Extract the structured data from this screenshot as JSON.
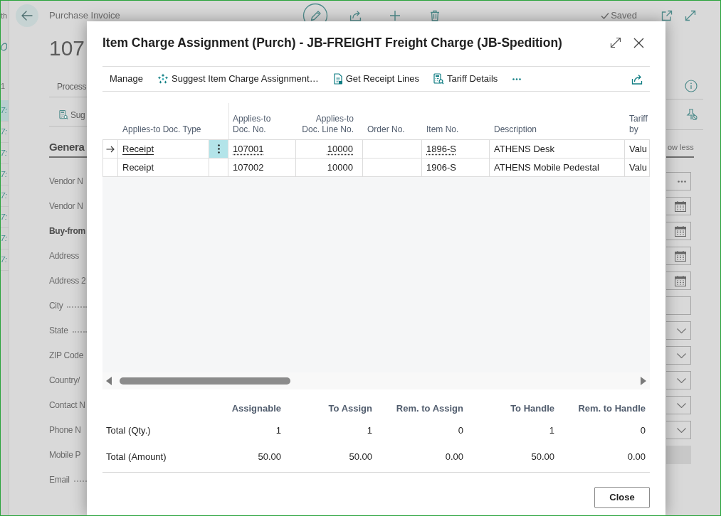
{
  "background_page": {
    "edge_strip": {
      "heading": "th",
      "label": "1",
      "rows": [
        {
          "text": "7:",
          "selected": true
        },
        {
          "text": "7:",
          "selected": false
        },
        {
          "text": "7:",
          "selected": false
        },
        {
          "text": "7:",
          "selected": false
        },
        {
          "text": "7:",
          "selected": false
        },
        {
          "text": "7:",
          "selected": false
        },
        {
          "text": "7:",
          "selected": false
        },
        {
          "text": "7:",
          "selected": false
        }
      ]
    },
    "title": "Purchase Invoice",
    "status": "Saved",
    "number": "107",
    "tab": "Process",
    "action": "Sug",
    "section": {
      "title": "Genera",
      "toggle": "ow less"
    },
    "labels": [
      {
        "text": "Vendor N",
        "kind": "plain"
      },
      {
        "text": "Vendor N",
        "kind": "plain"
      },
      {
        "text": "Buy-from",
        "kind": "group"
      },
      {
        "text": "Address",
        "kind": "plain"
      },
      {
        "text": "Address 2",
        "kind": "plain"
      },
      {
        "text": "City",
        "kind": "dotted"
      },
      {
        "text": "State",
        "kind": "dotted"
      },
      {
        "text": "ZIP Code",
        "kind": "plain"
      },
      {
        "text": "Country/",
        "kind": "plain"
      },
      {
        "text": "Contact N",
        "kind": "plain"
      },
      {
        "text": "Phone N",
        "kind": "plain"
      },
      {
        "text": "Mobile P",
        "kind": "plain"
      },
      {
        "text": "Email",
        "kind": "dotted"
      }
    ],
    "fields": [
      {
        "kind": "lookup"
      },
      {
        "kind": "date"
      },
      {
        "kind": "date"
      },
      {
        "kind": "date"
      },
      {
        "kind": "date"
      },
      {
        "kind": "text"
      },
      {
        "kind": "dropdown"
      },
      {
        "kind": "dropdown"
      },
      {
        "kind": "dropdown"
      },
      {
        "kind": "dropdown"
      },
      {
        "kind": "dropdown"
      },
      {
        "kind": "disabled"
      }
    ]
  },
  "dialog": {
    "title": "Item Charge Assignment (Purch) - JB-FREIGHT Freight Charge (JB-Spedition)",
    "actions": [
      {
        "label": "Manage",
        "kind": "menu"
      },
      {
        "label": "Suggest Item Charge Assignment…",
        "kind": "suggest"
      },
      {
        "label": "Get Receipt Lines",
        "kind": "receipt"
      },
      {
        "label": "Tariff Details",
        "kind": "tariff"
      }
    ],
    "table": {
      "columns": [
        {
          "label": "Applies-to Doc. Type",
          "kind": "link"
        },
        {
          "label": "Applies-to Doc. No.",
          "kind": "lookup"
        },
        {
          "label": "Applies-to Doc. Line No.",
          "kind": "number"
        },
        {
          "label": "Order No.",
          "kind": "text"
        },
        {
          "label": "Item No.",
          "kind": "lookup"
        },
        {
          "label": "Description",
          "kind": "text"
        },
        {
          "label": "Tariff by",
          "kind": "text"
        }
      ],
      "rows": [
        {
          "selected": true,
          "doc_type": "Receipt",
          "doc_no": "107001",
          "line_no": "10000",
          "item_no": "1896-S",
          "description": "ATHENS Desk",
          "tariff_by": "Valu"
        },
        {
          "selected": false,
          "doc_type": "Receipt",
          "doc_no": "107002",
          "line_no": "10000",
          "item_no": "1906-S",
          "description": "ATHENS Mobile Pedestal",
          "tariff_by": "Valu"
        }
      ]
    },
    "totals": {
      "columns": [
        "Assignable",
        "To Assign",
        "Rem. to Assign",
        "To Handle",
        "Rem. to Handle"
      ],
      "rows": [
        {
          "label": "Total (Qty.)",
          "values": [
            "1",
            "1",
            "0",
            "1",
            "0"
          ]
        },
        {
          "label": "Total (Amount)",
          "values": [
            "50.00",
            "50.00",
            "0.00",
            "50.00",
            "0.00"
          ]
        }
      ]
    },
    "buttons": [
      "Close"
    ]
  }
}
